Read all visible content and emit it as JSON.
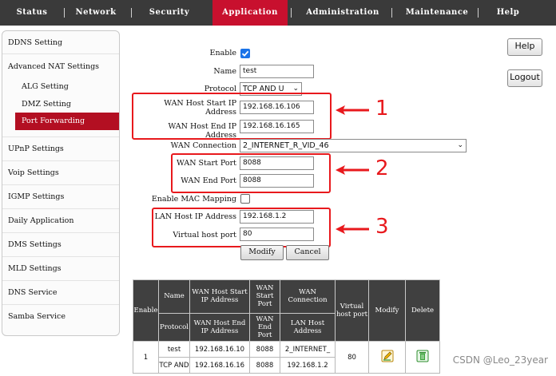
{
  "nav": {
    "tabs": [
      "Status",
      "Network",
      "Security",
      "Application",
      "Administration",
      "Maintenance",
      "Help"
    ],
    "active": "Application"
  },
  "sidebar": {
    "items": [
      "DDNS Setting",
      "Advanced NAT Settings",
      "ALG Setting",
      "DMZ Setting",
      "Port Forwarding",
      "UPnP Settings",
      "Voip Settings",
      "IGMP Settings",
      "Daily Application",
      "DMS Settings",
      "MLD Settings",
      "DNS Service",
      "Samba Service"
    ],
    "selected": "Port Forwarding"
  },
  "form": {
    "enable_label": "Enable",
    "enable_checked": true,
    "name_label": "Name",
    "name_value": "test",
    "protocol_label": "Protocol",
    "protocol_value": "TCP AND U",
    "wan_host_start_label_1": "WAN Host Start IP",
    "wan_host_start_label_2": "Address",
    "wan_host_start_value": "192.168.16.106",
    "wan_host_end_label": "WAN Host End IP Address",
    "wan_host_end_value": "192.168.16.165",
    "wan_connection_label": "WAN Connection",
    "wan_connection_value": "2_INTERNET_R_VID_46",
    "wan_start_port_label": "WAN Start Port",
    "wan_start_port_value": "8088",
    "wan_end_port_label": "WAN End Port",
    "wan_end_port_value": "8088",
    "enable_mac_label": "Enable MAC Mapping",
    "enable_mac_checked": false,
    "lan_host_label": "LAN Host IP Address",
    "lan_host_value": "192.168.1.2",
    "virtual_port_label": "Virtual host port",
    "virtual_port_value": "80",
    "modify_button": "Modify",
    "cancel_button": "Cancel"
  },
  "annotations": [
    "1",
    "2",
    "3"
  ],
  "right_buttons": {
    "help": "Help",
    "logout": "Logout"
  },
  "table": {
    "head_enable": "Enable",
    "head_name": "Name",
    "head_protocol": "Protocol",
    "head_wan_start_ip": "WAN Host Start IP Address",
    "head_wan_end_ip": "WAN Host End IP Address",
    "head_wan_start_port": "WAN Start Port",
    "head_wan_end_port": "WAN End Port",
    "head_wan_conn": "WAN Connection",
    "head_lan_ip": "LAN Host Address",
    "head_virtual_port": "Virtual host port",
    "head_modify": "Modify",
    "head_delete": "Delete",
    "row": {
      "enable": "1",
      "name": "test",
      "protocol": "TCP AND",
      "wan_start_ip": "192.168.16.10",
      "wan_end_ip": "192.168.16.16",
      "wan_start_port": "8088",
      "wan_end_port": "8088",
      "wan_conn": "2_INTERNET_",
      "lan_ip": "192.168.1.2",
      "virtual_port": "80"
    }
  },
  "watermark": "CSDN @Leo_23year",
  "colors": {
    "accent_red": "#c8102e",
    "annotation_red": "#e8191d",
    "nav_bg": "#3a3a3a"
  }
}
